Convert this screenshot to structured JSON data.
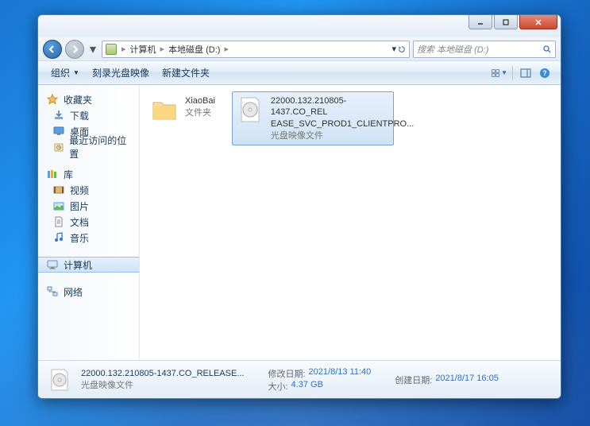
{
  "address": {
    "crumb1": "计算机",
    "crumb2": "本地磁盘 (D:)"
  },
  "search": {
    "placeholder": "搜索 本地磁盘 (D:)"
  },
  "toolbar": {
    "organize": "组织",
    "burn": "刻录光盘映像",
    "newfolder": "新建文件夹"
  },
  "sidebar": {
    "favorites": "收藏夹",
    "downloads": "下载",
    "desktop": "桌面",
    "recent": "最近访问的位置",
    "libraries": "库",
    "videos": "视频",
    "pictures": "图片",
    "documents": "文档",
    "music": "音乐",
    "computer": "计算机",
    "network": "网络"
  },
  "files": {
    "folder1": {
      "name": "XiaoBai",
      "type": "文件夹"
    },
    "iso1": {
      "line1": "22000.132.210805-1437.CO_REL",
      "line2": "EASE_SVC_PROD1_CLIENTPRO...",
      "type": "光盘映像文件"
    }
  },
  "status": {
    "name": "22000.132.210805-1437.CO_RELEASE...",
    "type": "光盘映像文件",
    "mod_lbl": "修改日期:",
    "mod_val": "2021/8/13 11:40",
    "size_lbl": "大小:",
    "size_val": "4.37 GB",
    "created_lbl": "创建日期:",
    "created_val": "2021/8/17 16:05"
  }
}
